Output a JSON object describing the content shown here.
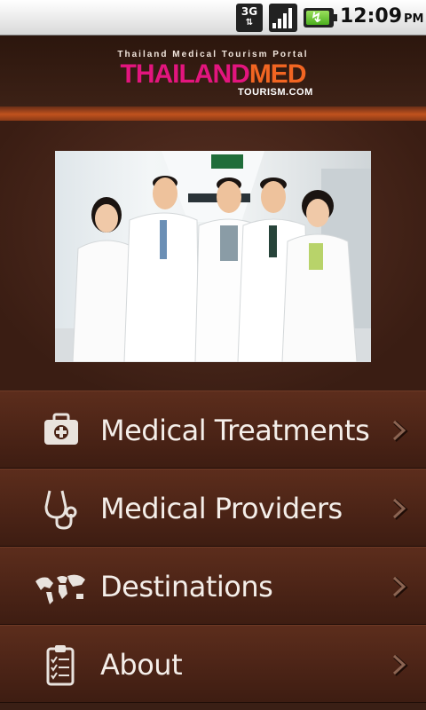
{
  "status_bar": {
    "network": "3G",
    "network_arrows": "⇅",
    "time": "12:09",
    "ampm": "PM"
  },
  "header": {
    "tagline": "Thailand Medical Tourism Portal",
    "logo_part1": "THAILAND",
    "logo_part2": "MED",
    "logo_sub": "TOURISM.COM"
  },
  "colors": {
    "logo_pink": "#e3157e",
    "logo_orange": "#f26522",
    "menu_bg": "#4a2316"
  },
  "menu": {
    "items": [
      {
        "label": "Medical Treatments",
        "icon": "first-aid-kit-icon"
      },
      {
        "label": "Medical Providers",
        "icon": "stethoscope-icon"
      },
      {
        "label": "Destinations",
        "icon": "world-map-icon"
      },
      {
        "label": "About",
        "icon": "clipboard-icon"
      }
    ]
  }
}
